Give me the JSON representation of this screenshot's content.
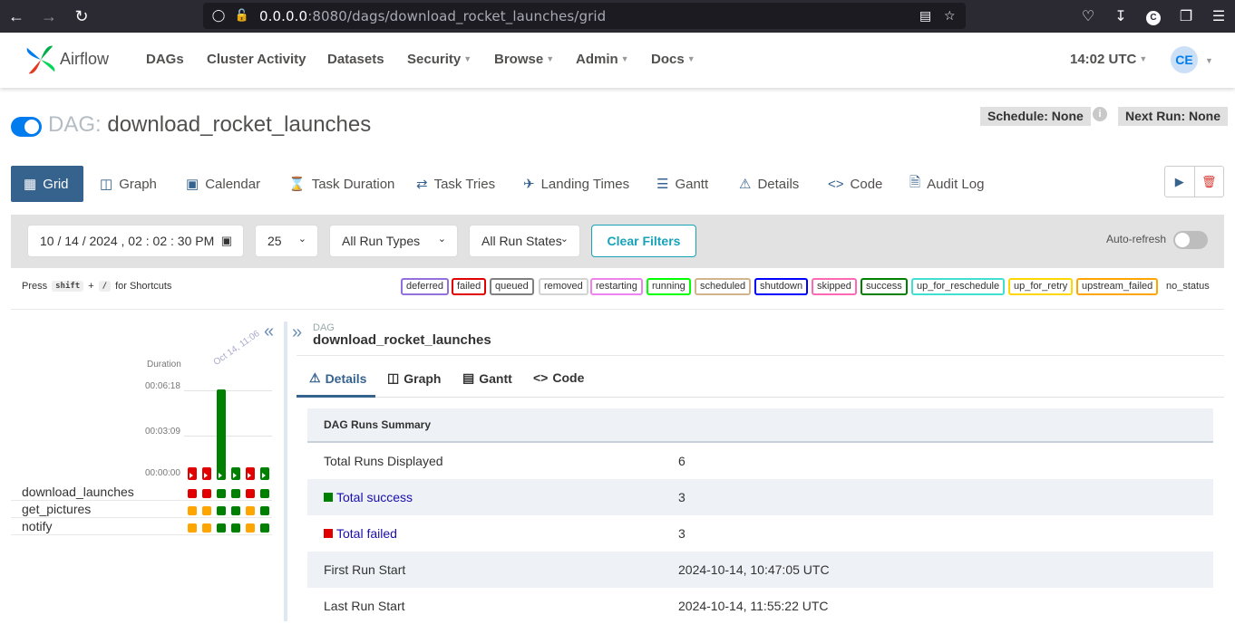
{
  "browser": {
    "url_host": "0.0.0.0",
    "url_rest": ":8080/dags/download_rocket_launches/grid",
    "extension_letter": "C"
  },
  "nav": {
    "brand": "Airflow",
    "items": [
      "DAGs",
      "Cluster Activity",
      "Datasets",
      "Security",
      "Browse",
      "Admin",
      "Docs"
    ],
    "clock": "14:02 UTC",
    "avatar_initials": "CE"
  },
  "dag": {
    "label": "DAG:",
    "name": "download_rocket_launches",
    "schedule": "Schedule: None",
    "next_run": "Next Run: None"
  },
  "tabs": [
    "Grid",
    "Graph",
    "Calendar",
    "Task Duration",
    "Task Tries",
    "Landing Times",
    "Gantt",
    "Details",
    "Code",
    "Audit Log"
  ],
  "filters": {
    "datetime": "10 / 14 / 2024 ,  02 : 02 : 30   PM",
    "num_runs": "25",
    "run_types": "All Run Types",
    "run_states": "All Run States",
    "clear_label": "Clear Filters",
    "auto_refresh_label": "Auto-refresh"
  },
  "shortcut": {
    "press": "Press",
    "k1": "shift",
    "plus": "+",
    "k2": "/",
    "suffix": "for Shortcuts"
  },
  "legend": [
    {
      "label": "deferred",
      "color": "#9370db"
    },
    {
      "label": "failed",
      "color": "#e00000"
    },
    {
      "label": "queued",
      "color": "#808080"
    },
    {
      "label": "removed",
      "color": "#d3d3d3"
    },
    {
      "label": "restarting",
      "color": "#ee82ee"
    },
    {
      "label": "running",
      "color": "#00ff00"
    },
    {
      "label": "scheduled",
      "color": "#d2b48c"
    },
    {
      "label": "shutdown",
      "color": "#0000ff"
    },
    {
      "label": "skipped",
      "color": "#ff69b4"
    },
    {
      "label": "success",
      "color": "#008000"
    },
    {
      "label": "up_for_reschedule",
      "color": "#40e0d0"
    },
    {
      "label": "up_for_retry",
      "color": "#ffd700"
    },
    {
      "label": "upstream_failed",
      "color": "#ffa500"
    },
    {
      "label": "no_status",
      "color": "#ffffff"
    }
  ],
  "grid": {
    "duration_label": "Duration",
    "date_label": "Oct 14, 11:06",
    "ticks": [
      "00:06:18",
      "00:03:09",
      "00:00:00"
    ],
    "run_states": [
      "failed",
      "failed",
      "success",
      "success",
      "failed",
      "success"
    ],
    "run_durations_sec": [
      0,
      0,
      378,
      0,
      0,
      0
    ],
    "tasks": [
      {
        "name": "download_launches",
        "states": [
          "failed",
          "failed",
          "success",
          "success",
          "failed",
          "success"
        ]
      },
      {
        "name": "get_pictures",
        "states": [
          "upstream_failed",
          "upstream_failed",
          "success",
          "success",
          "upstream_failed",
          "success"
        ]
      },
      {
        "name": "notify",
        "states": [
          "upstream_failed",
          "upstream_failed",
          "success",
          "success",
          "upstream_failed",
          "success"
        ]
      }
    ]
  },
  "details": {
    "dag_small": "DAG",
    "dag_name": "download_rocket_launches",
    "subtabs": [
      "Details",
      "Graph",
      "Gantt",
      "Code"
    ],
    "summary_title": "DAG Runs Summary",
    "rows": [
      {
        "k": "Total Runs Displayed",
        "v": "6"
      },
      {
        "k": "Total success",
        "v": "3"
      },
      {
        "k": "Total failed",
        "v": "3"
      },
      {
        "k": "First Run Start",
        "v": "2024-10-14, 10:47:05 UTC"
      },
      {
        "k": "Last Run Start",
        "v": "2024-10-14, 11:55:22 UTC"
      }
    ]
  },
  "colors": {
    "success": "#008000",
    "failed": "#e00000",
    "upstream_failed": "#ffa500",
    "accent": "#017cee",
    "tab_active": "#36628e"
  }
}
